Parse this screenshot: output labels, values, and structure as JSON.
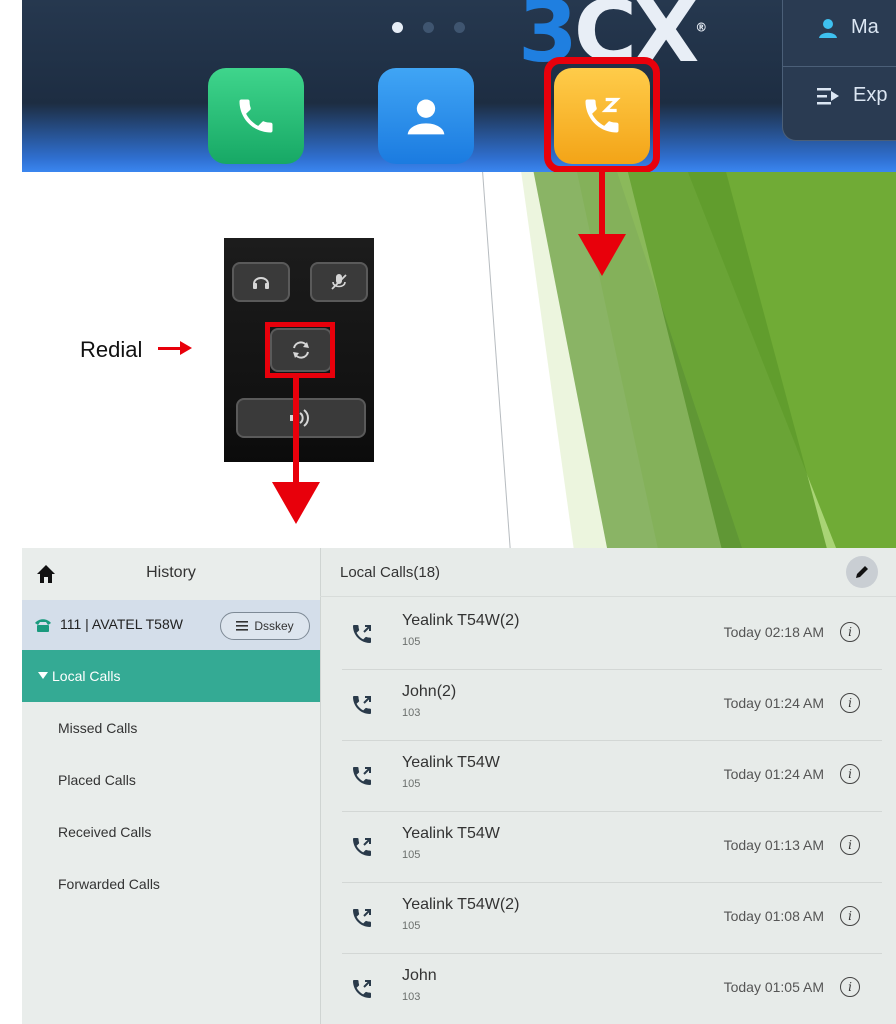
{
  "top_screen": {
    "brand": "3CX",
    "brand_mark": "®",
    "menu": [
      {
        "label": "Ma",
        "icon": "person-icon"
      },
      {
        "label": "Exp",
        "icon": "expand-icon"
      }
    ],
    "apps": [
      {
        "name": "phone",
        "icon": "phone-icon",
        "color": "#1fb871"
      },
      {
        "name": "contacts",
        "icon": "contact-icon",
        "color": "#2a8ff0"
      },
      {
        "name": "history",
        "icon": "call-history-icon",
        "color": "#f6b42b"
      }
    ],
    "page_dots": 3,
    "highlight_color": "#e8000b"
  },
  "keypad": {
    "label": "Redial",
    "keys": [
      "headset-icon",
      "mute-icon",
      "redial-icon",
      "speaker-icon"
    ]
  },
  "history": {
    "title": "History",
    "account": "111 | AVATEL T58W",
    "dsskey_label": "Dsskey",
    "nav": [
      {
        "label": "Local Calls",
        "active": true
      },
      {
        "label": "Missed Calls",
        "active": false
      },
      {
        "label": "Placed Calls",
        "active": false
      },
      {
        "label": "Received Calls",
        "active": false
      },
      {
        "label": "Forwarded Calls",
        "active": false
      }
    ],
    "list_title": "Local Calls(18)",
    "calls": [
      {
        "name": "Yealink T54W(2)",
        "number": "105",
        "time": "Today 02:18 AM"
      },
      {
        "name": "John(2)",
        "number": "103",
        "time": "Today 01:24 AM"
      },
      {
        "name": "Yealink T54W",
        "number": "105",
        "time": "Today 01:24 AM"
      },
      {
        "name": "Yealink T54W",
        "number": "105",
        "time": "Today 01:13 AM"
      },
      {
        "name": "Yealink T54W(2)",
        "number": "105",
        "time": "Today 01:08 AM"
      },
      {
        "name": "John",
        "number": "103",
        "time": "Today 01:05 AM"
      }
    ],
    "accent_color": "#34aa94"
  }
}
